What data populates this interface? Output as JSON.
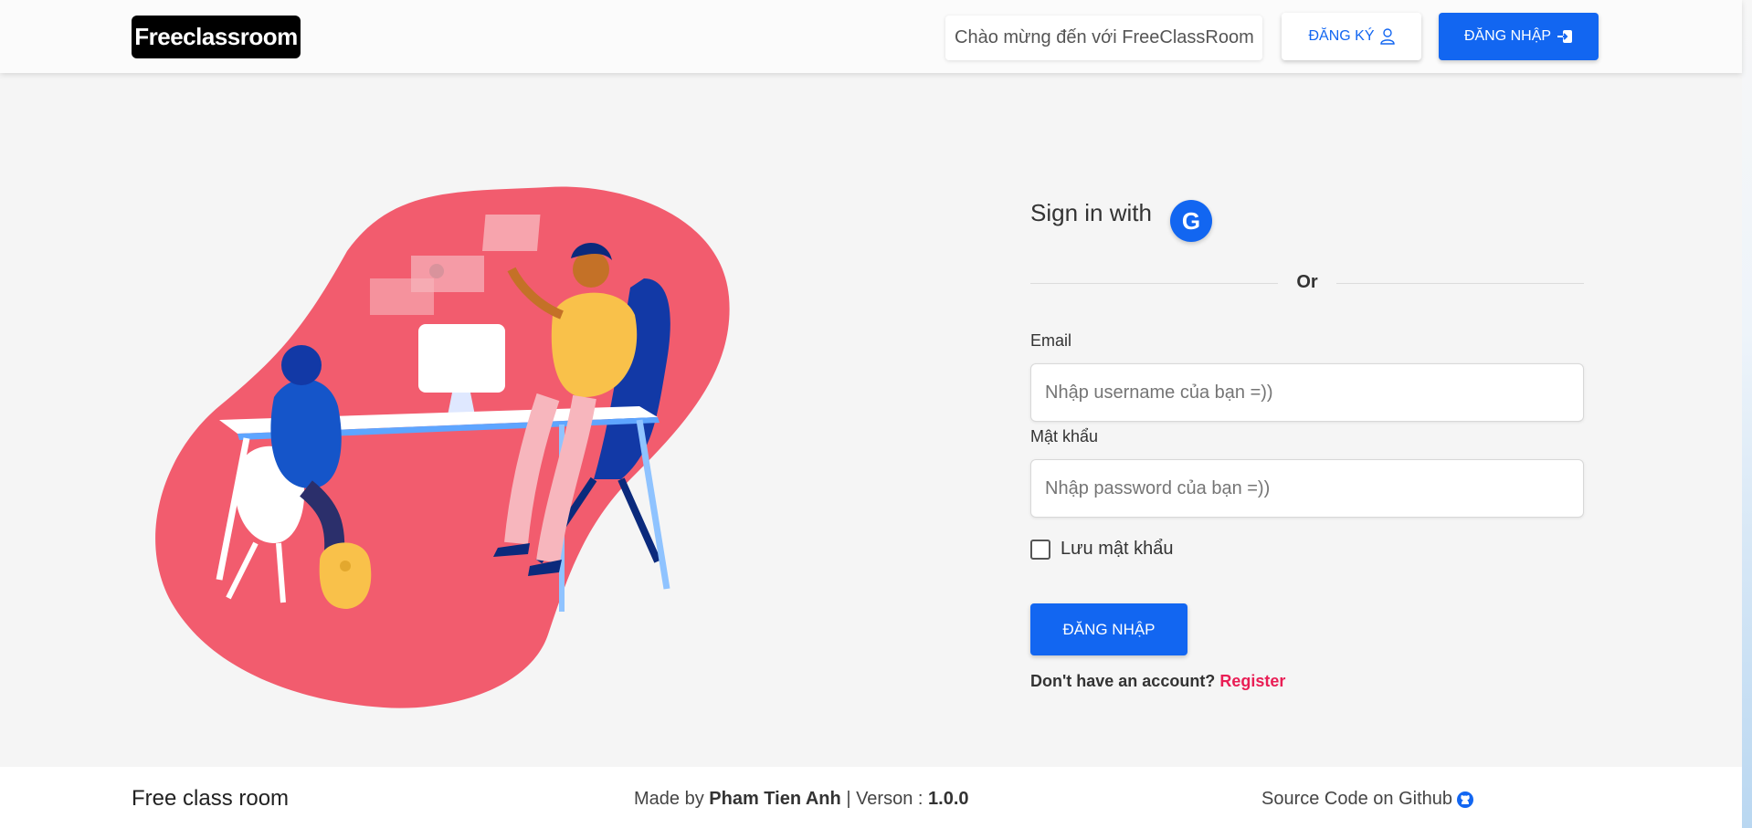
{
  "navbar": {
    "logo": "Freeclassroom",
    "welcome": "Chào mừng đến với FreeClassRoom",
    "register_label": "ĐĂNG KÝ",
    "login_label": "ĐĂNG NHẬP"
  },
  "form": {
    "signin_label": "Sign in with",
    "google_letter": "G",
    "or_label": "Or",
    "email_label": "Email",
    "email_placeholder": "Nhập username của bạn =))",
    "password_label": "Mật khẩu",
    "password_placeholder": "Nhập password của bạn =))",
    "remember_label": "Lưu mật khẩu",
    "submit_label": "ĐĂNG NHẬP",
    "no_account_text": "Don't have an account?",
    "register_link": "Register"
  },
  "footer": {
    "left": "Free class room",
    "made_by_prefix": "Made by",
    "author": "Pham Tien Anh",
    "version_prefix": "| Verson :",
    "version": "1.0.0",
    "source_text": "Source Code on Github"
  },
  "colors": {
    "primary": "#1266f1",
    "accent_red": "#e91e55",
    "blob": "#f25c6e"
  }
}
